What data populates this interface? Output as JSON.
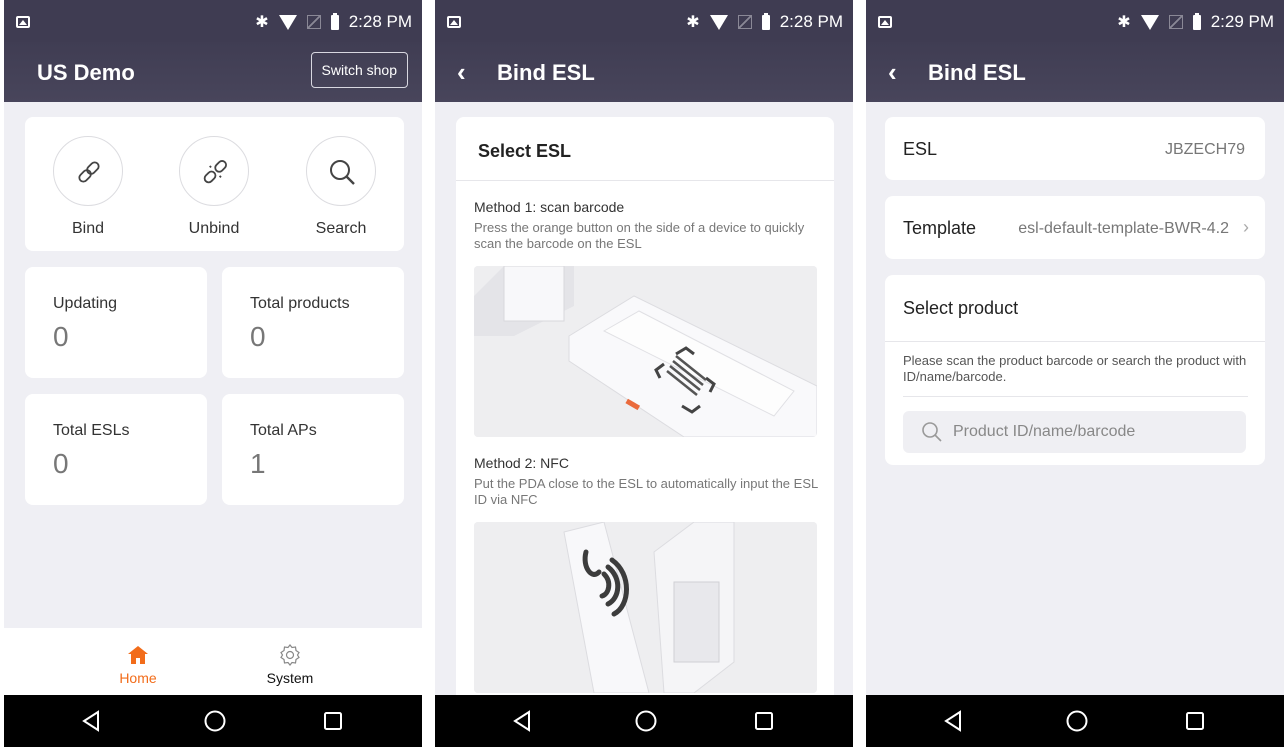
{
  "status": {
    "time1": "2:28 PM",
    "time2": "2:28 PM",
    "time3": "2:29 PM"
  },
  "home": {
    "title": "US Demo",
    "switch_label": "Switch shop",
    "actions": [
      {
        "label": "Bind"
      },
      {
        "label": "Unbind"
      },
      {
        "label": "Search"
      }
    ],
    "stats": [
      {
        "label": "Updating",
        "value": "0"
      },
      {
        "label": "Total products",
        "value": "0"
      },
      {
        "label": "Total ESLs",
        "value": "0"
      },
      {
        "label": "Total APs",
        "value": "1"
      }
    ],
    "tabs": [
      {
        "label": "Home"
      },
      {
        "label": "System"
      }
    ],
    "accent": "#f26c1a"
  },
  "select": {
    "title": "Bind ESL",
    "section": "Select ESL",
    "method1_title": "Method 1: scan barcode",
    "method1_desc": "Press the orange button on the side of a device to quickly scan the barcode on the ESL",
    "method2_title": "Method 2: NFC",
    "method2_desc": "Put the PDA close to the ESL to automatically input the ESL ID via NFC"
  },
  "bind": {
    "title": "Bind ESL",
    "esl_label": "ESL",
    "esl_value": "JBZECH79",
    "template_label": "Template",
    "template_value": "esl-default-template-BWR-4.2",
    "product_title": "Select product",
    "product_hint": "Please scan the product barcode or search the product with ID/name/barcode.",
    "search_placeholder": "Product ID/name/barcode"
  }
}
